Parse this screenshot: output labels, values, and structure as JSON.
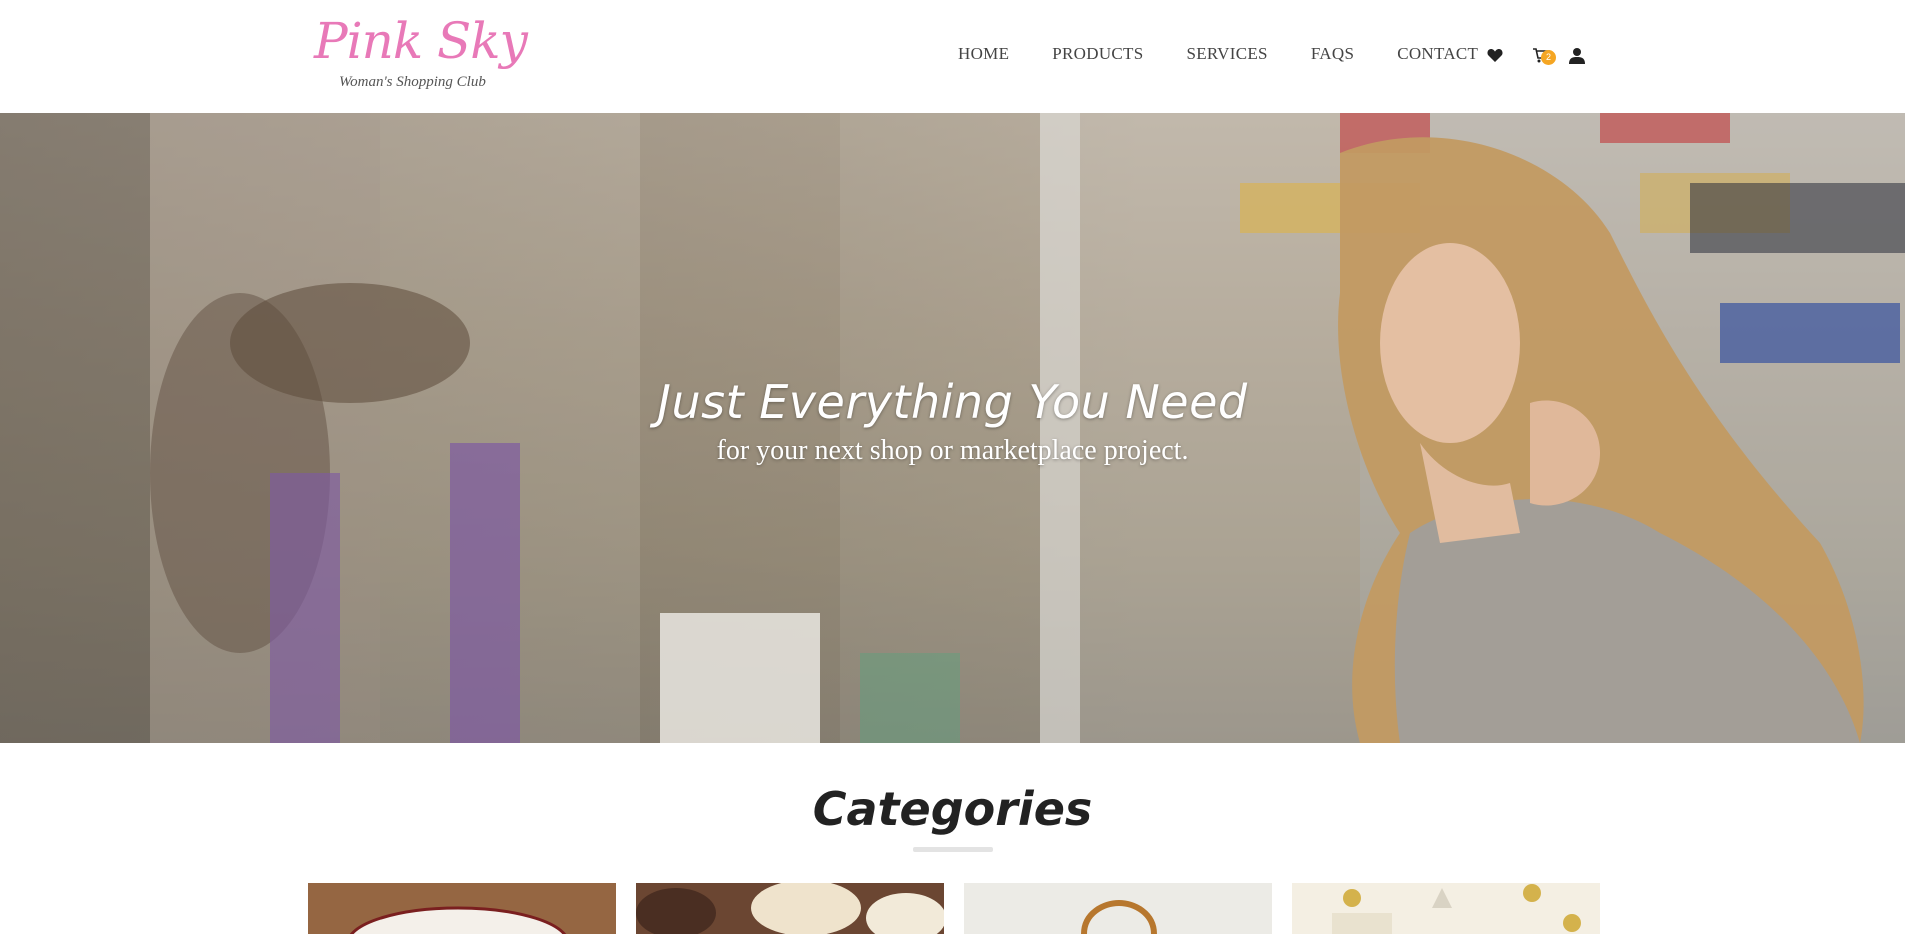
{
  "brand": {
    "name": "Pink Sky",
    "tagline": "Woman's Shopping Club"
  },
  "nav": {
    "links": [
      "HOME",
      "PRODUCTS",
      "SERVICES",
      "FAQS",
      "CONTACT"
    ],
    "icons": [
      "heart-icon",
      "cart-icon",
      "user-icon"
    ],
    "cart_count": "2"
  },
  "hero": {
    "title": "Just Everything You Need",
    "subtitle": "for your next shop or marketplace project."
  },
  "categories": {
    "heading": "Categories",
    "cards": [
      {
        "image": "category-image-plate"
      },
      {
        "image": "category-image-cupcakes"
      },
      {
        "image": "category-image-basket"
      },
      {
        "image": "category-image-gifts"
      }
    ]
  },
  "colors": {
    "brand_pink": "#e879b8",
    "badge_orange": "#f5a623",
    "nav_text": "#444444"
  }
}
